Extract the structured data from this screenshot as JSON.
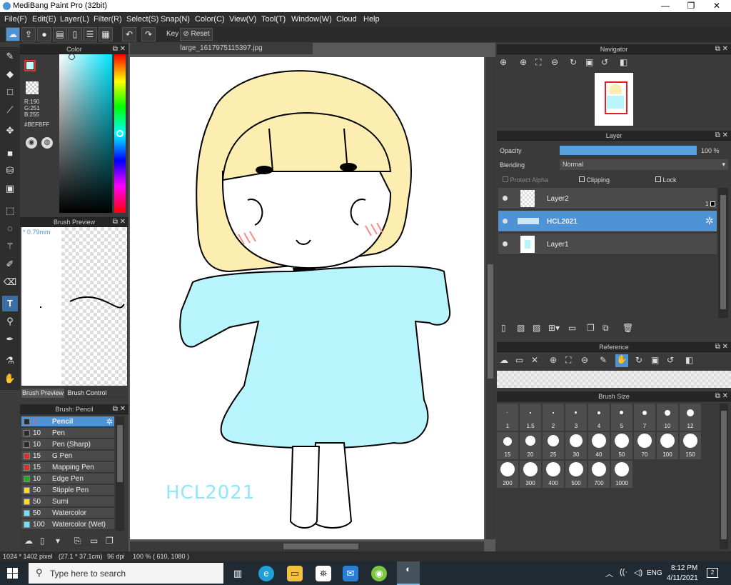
{
  "window": {
    "title": "MediBang Paint Pro (32bit)"
  },
  "menu": [
    "File(F)",
    "Edit(E)",
    "Layer(L)",
    "Filter(R)",
    "Select(S)",
    "Snap(N)",
    "Color(C)",
    "View(V)",
    "Tool(T)",
    "Window(W)",
    "Cloud",
    "Help"
  ],
  "toolbar": {
    "key_label": "Key",
    "reset_label": "Reset"
  },
  "color_panel": {
    "title": "Color",
    "r": "R:190",
    "g": "G:251",
    "b": "B:255",
    "hex": "#BEFBFF",
    "current_color": "#befbff"
  },
  "brush_preview": {
    "title": "Brush Preview",
    "size": "* 0.79mm",
    "tab_preview": "Brush Preview",
    "tab_control": "Brush Control"
  },
  "brush_list": {
    "title": "Brush: Pencil",
    "items": [
      {
        "size": "3",
        "name": "Pencil",
        "color": "#2b2b2b"
      },
      {
        "size": "10",
        "name": "Pen",
        "color": "#2b2b2b"
      },
      {
        "size": "10",
        "name": "Pen (Sharp)",
        "color": "#2b2b2b"
      },
      {
        "size": "15",
        "name": "G Pen",
        "color": "#e02b2b"
      },
      {
        "size": "15",
        "name": "Mapping Pen",
        "color": "#e02b2b"
      },
      {
        "size": "10",
        "name": "Edge Pen",
        "color": "#22aa22"
      },
      {
        "size": "50",
        "name": "Stipple Pen",
        "color": "#f0e020"
      },
      {
        "size": "50",
        "name": "Sumi",
        "color": "#f0e020"
      },
      {
        "size": "50",
        "name": "Watercolor",
        "color": "#70e0f8"
      },
      {
        "size": "100",
        "name": "Watercolor (Wet)",
        "color": "#70e0f8"
      }
    ]
  },
  "document": {
    "tab": "large_1617975115397.jpg",
    "signature": "HCL2021"
  },
  "navigator": {
    "title": "Navigator"
  },
  "layer_panel": {
    "title": "Layer",
    "opacity_label": "Opacity",
    "opacity_value": "100 %",
    "opacity_level": 1.0,
    "blending_label": "Blending",
    "blending_value": "Normal",
    "protect_alpha": "Protect Alpha",
    "clipping": "Clipping",
    "lock": "Lock",
    "layers": [
      {
        "name": "Layer2",
        "badge": "1"
      },
      {
        "name": "HCL2021"
      },
      {
        "name": "Layer1"
      }
    ]
  },
  "reference": {
    "title": "Reference"
  },
  "brush_size": {
    "title": "Brush Size",
    "sizes": [
      "1",
      "1.5",
      "2",
      "3",
      "4",
      "5",
      "7",
      "10",
      "12",
      "15",
      "20",
      "25",
      "30",
      "40",
      "50",
      "70",
      "100",
      "150",
      "200",
      "300",
      "400",
      "500",
      "700",
      "1000"
    ]
  },
  "status": {
    "dimensions": "1024 * 1402 pixel",
    "physical": "(27.1 * 37.1cm)",
    "dpi": "96 dpi",
    "zoom": "100 %",
    "cursor": "( 610, 1080 )"
  },
  "taskbar": {
    "search_placeholder": "Type here to search",
    "lang": "ENG",
    "time": "8:12 PM",
    "date": "4/11/2021",
    "notif_count": "2"
  }
}
